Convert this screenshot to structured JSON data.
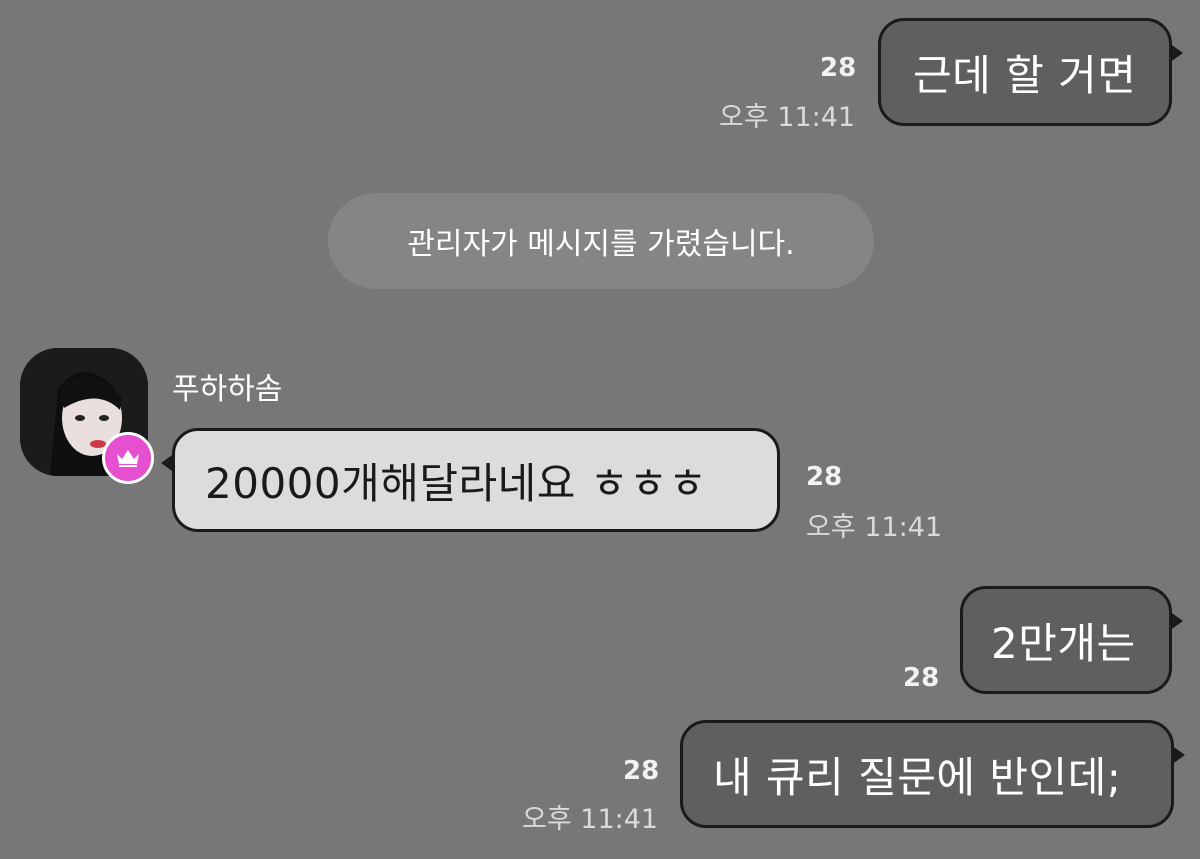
{
  "messages": [
    {
      "id": "m1",
      "side": "mine",
      "text": "근데 할 거면",
      "read_count": "28",
      "time": "오후 11:41"
    },
    {
      "id": "m2",
      "side": "theirs",
      "sender": "푸하하솜",
      "text": "20000개해달라네요 ㅎㅎㅎ",
      "read_count": "28",
      "time": "오후 11:41"
    },
    {
      "id": "m3",
      "side": "mine",
      "text": "2만개는",
      "read_count": "28"
    },
    {
      "id": "m4",
      "side": "mine",
      "text": "내 큐리 질문에 반인데;",
      "read_count": "28",
      "time": "오후 11:41"
    }
  ],
  "notice": {
    "text": "관리자가 메시지를 가렸습니다."
  },
  "icons": {
    "avatar": "profile-photo",
    "badge": "crown-icon"
  },
  "colors": {
    "background": "#777777",
    "my_bubble": "#5f5f5f",
    "their_bubble": "#dcdcdc",
    "badge": "#e64fcf"
  }
}
